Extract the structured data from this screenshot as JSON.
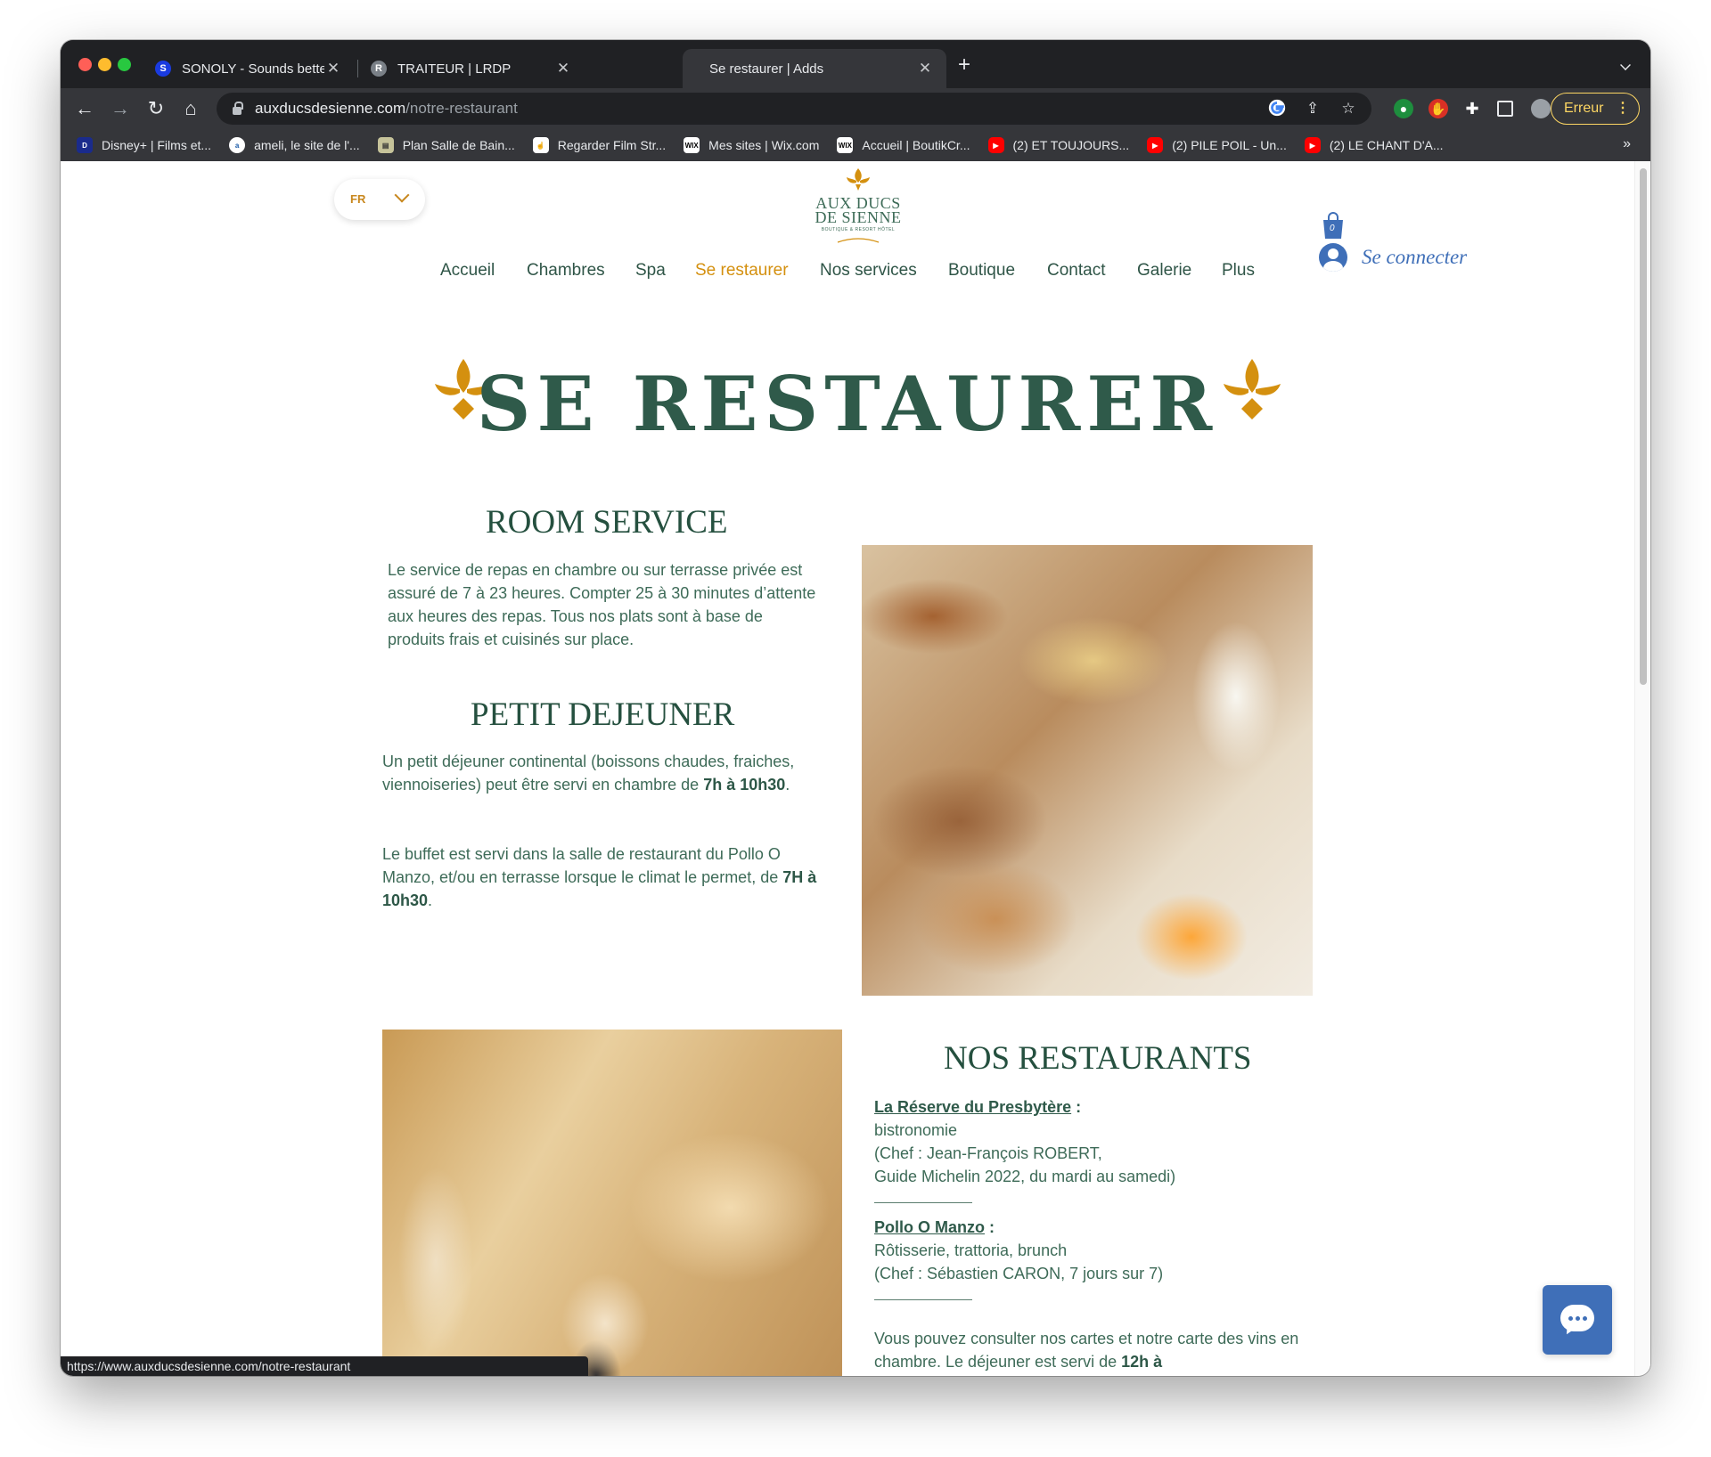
{
  "browser": {
    "tabs": [
      {
        "title": "SONOLY - Sounds better",
        "favicon": "S"
      },
      {
        "title": "TRAITEUR | LRDP",
        "favicon": "R"
      },
      {
        "title": "Se restaurer | Adds",
        "favicon": ""
      }
    ],
    "url_host": "auxducsdesienne.com",
    "url_path": "/notre-restaurant",
    "profile_button": "Erreur",
    "bookmarks": [
      "Disney+ | Films et...",
      "ameli, le site de l'...",
      "Plan Salle de Bain...",
      "Regarder Film Str...",
      "Mes sites | Wix.com",
      "Accueil | BoutikCr...",
      "(2) ET TOUJOURS...",
      "(2) PILE POIL - Un...",
      "(2) LE CHANT D'A..."
    ],
    "bookmarks_more": "»",
    "status_url": "https://www.auxducsdesienne.com/notre-restaurant"
  },
  "header": {
    "language": "FR",
    "logo": {
      "line1": "AUX DUCS",
      "line2": "DE SIENNE",
      "tagline": "BOUTIQUE & RESORT HÔTEL"
    },
    "nav": [
      "Accueil",
      "Chambres",
      "Spa",
      "Se restaurer",
      "Nos services",
      "Boutique",
      "Contact",
      "Galerie",
      "Plus"
    ],
    "active_nav": "Se restaurer",
    "cart_count": "0",
    "login": "Se connecter"
  },
  "page": {
    "title": "SE RESTAURER",
    "room_service": {
      "title": "ROOM SERVICE",
      "text": "Le service de repas en chambre ou sur terrasse privée est assuré de 7 à 23 heures. Compter 25 à 30 minutes d’attente aux heures des repas. Tous nos plats sont à base de produits frais et cuisinés sur place."
    },
    "breakfast": {
      "title": "PETIT DEJEUNER",
      "p1_a": "Un petit déjeuner continental (boissons chaudes, fraiches, viennoiseries) peut être servi en chambre de ",
      "p1_b": "7h à 10h30",
      "p1_c": ".",
      "p2_a": "Le buffet est servi dans la salle de restaurant du Pollo O Manzo, et/ou en terrasse lorsque le climat le permet, de ",
      "p2_b": "7H à 10h30",
      "p2_c": "."
    },
    "restaurants": {
      "title": "NOS RESTAURANTS",
      "r1_name": "La Réserve du Presbytère",
      "r1_colon": " :",
      "r1_type": "bistronomie",
      "r1_chef": "(Chef : Jean-François ROBERT,",
      "r1_extra": "Guide Michelin 2022, du mardi au samedi)",
      "r2_name": "Pollo O Manzo",
      "r2_colon": " :",
      "r2_type": "Rôtisserie, trattoria, brunch",
      "r2_chef": "(Chef : Sébastien CARON, 7 jours sur 7)",
      "note_a": "Vous pouvez consulter nos cartes et notre carte des vins en chambre. Le déjeuner est servi de ",
      "note_b": "12h à"
    }
  },
  "colors": {
    "brand_green": "#2f5a4a",
    "accent_gold": "#d4900f",
    "link_blue": "#3f6fb8"
  }
}
